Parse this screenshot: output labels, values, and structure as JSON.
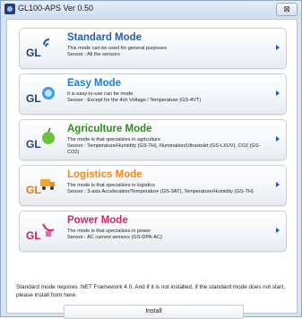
{
  "window": {
    "title": "GL100-APS Ver 0.50",
    "close_label": "⊠"
  },
  "modes": [
    {
      "name": "Standard Mode",
      "color": "#1f5fb7",
      "line1": "This mode can be used for general purposes",
      "line2": "Seosor : All the sensors",
      "icon": "gl-wireless-icon"
    },
    {
      "name": "Easy Mode",
      "color": "#1f7fd6",
      "line1": "It is easy-to-use can be mode",
      "line2": "Seosor : Except for the 4ch Voltage / Temperature (GS-4VT)",
      "icon": "gl-easy-icon"
    },
    {
      "name": "Agriculture Mode",
      "color": "#2e8c1c",
      "line1": "The mode is that specializes in agriculture",
      "line2": "Seosor : Temperature/Humidity (GS-TH), Illumination/Ultraviolet (GS-LXUV), CO2 (GS-CO2)",
      "icon": "gl-apple-icon"
    },
    {
      "name": "Logistics Mode",
      "color": "#f08a15",
      "line1": "The mode is that specializes in logistics",
      "line2": "Seosor : 3-axis Acceleration/Temperature (GS-3AT), Temperature/Humidity (GS-TH)",
      "icon": "gl-truck-icon"
    },
    {
      "name": "Power Mode",
      "color": "#d2236d",
      "line1": "The mode is that specializes in power",
      "line2": "Seosor : AC current sensors (GS-DPA-AC)",
      "icon": "gl-plug-icon"
    }
  ],
  "footer": {
    "note": "Standard mode requires .NET Framework 4.0. And if it is not installed, if the standard mode does not start, please install from here.",
    "install_label": "Install"
  }
}
